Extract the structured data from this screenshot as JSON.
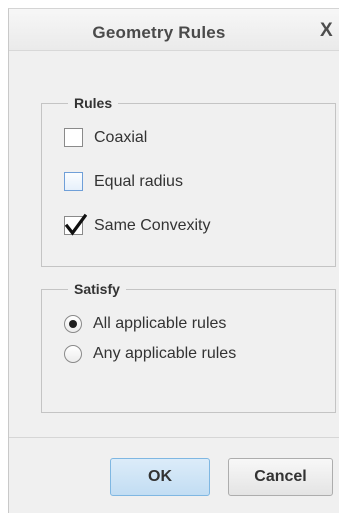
{
  "dialog": {
    "title": "Geometry Rules",
    "close_glyph": "X"
  },
  "rules_group": {
    "legend": "Rules",
    "options": [
      {
        "label": "Coaxial",
        "checked": false,
        "hover": false
      },
      {
        "label": "Equal radius",
        "checked": false,
        "hover": true
      },
      {
        "label": "Same Convexity",
        "checked": true,
        "hover": false
      }
    ]
  },
  "satisfy_group": {
    "legend": "Satisfy",
    "options": [
      {
        "label": "All applicable rules",
        "selected": true
      },
      {
        "label": "Any applicable rules",
        "selected": false
      }
    ]
  },
  "buttons": {
    "ok_label": "OK",
    "cancel_label": "Cancel"
  },
  "colors": {
    "dialog_background": "#f0f0f0",
    "ok_button_accent": "#c2ddf3",
    "hover_checkbox_border": "#6f9fd8"
  },
  "icons": {
    "close": "close-icon",
    "check": "checkmark-icon",
    "radio_dot": "radio-dot-icon"
  }
}
